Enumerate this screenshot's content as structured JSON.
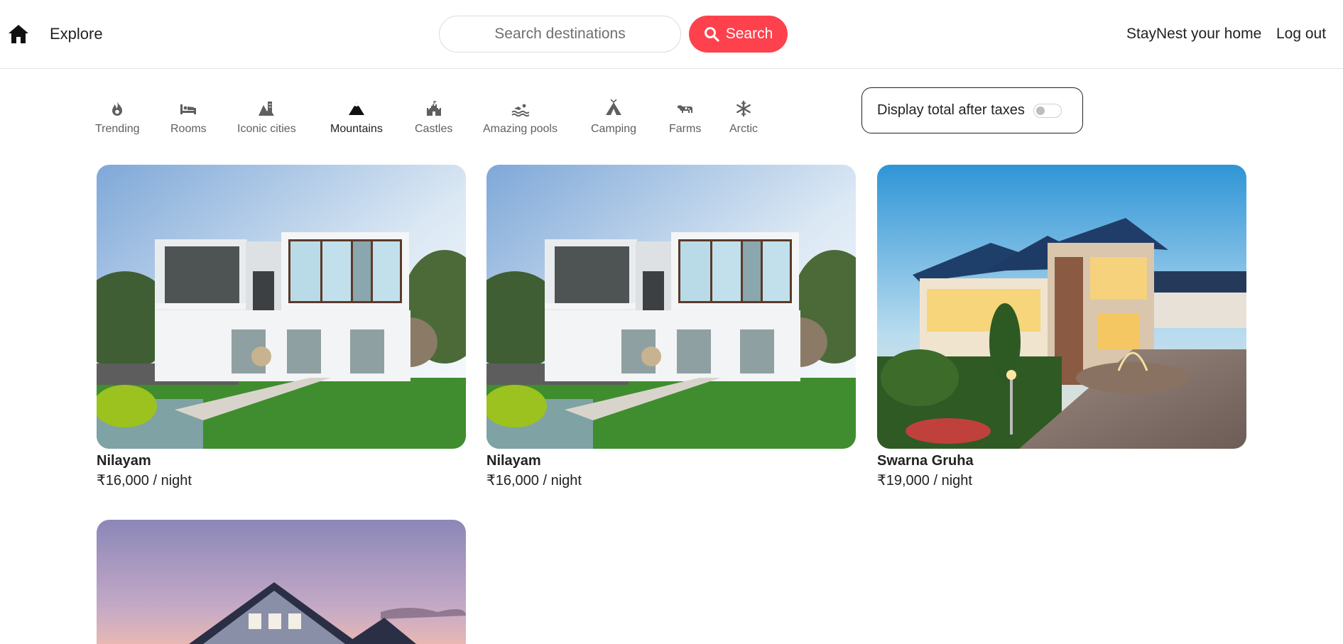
{
  "navbar": {
    "home_icon": "house-icon",
    "explore_label": "Explore",
    "search_placeholder": "Search destinations",
    "search_button_label": "Search",
    "host_label": "StayNest your home",
    "logout_label": "Log out",
    "accent_color": "#fe424d"
  },
  "filters": {
    "items": [
      {
        "label": "Trending",
        "icon": "flame-icon"
      },
      {
        "label": "Rooms",
        "icon": "bed-icon"
      },
      {
        "label": "Iconic cities",
        "icon": "city-icon"
      },
      {
        "label": "Mountains",
        "icon": "mountain-icon",
        "active": true
      },
      {
        "label": "Castles",
        "icon": "castle-icon"
      },
      {
        "label": "Amazing pools",
        "icon": "swimmer-icon"
      },
      {
        "label": "Camping",
        "icon": "tent-icon"
      },
      {
        "label": "Farms",
        "icon": "cow-icon"
      },
      {
        "label": "Arctic",
        "icon": "snowflake-icon"
      }
    ],
    "tax_toggle_label": "Display total after taxes",
    "tax_toggle_on": false
  },
  "listings": [
    {
      "title": "Nilayam",
      "price": "₹16,000 / night"
    },
    {
      "title": "Nilayam",
      "price": "₹16,000 / night"
    },
    {
      "title": "Swarna Gruha",
      "price": "₹19,000 / night"
    },
    {
      "title": "",
      "price": ""
    }
  ]
}
